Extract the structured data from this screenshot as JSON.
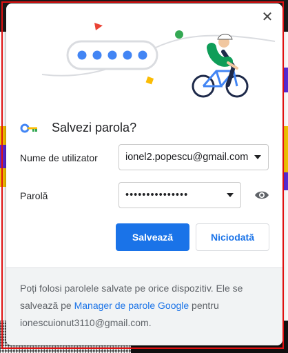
{
  "dialog": {
    "close_label": "✕",
    "title": "Salvezi parola?",
    "username_label": "Nume de utilizator",
    "username_value": "ionel2.popescu@gmail.com",
    "password_label": "Parolă",
    "password_value": "•••••••••••••••",
    "save_button": "Salvează",
    "never_button": "Niciodată"
  },
  "footer": {
    "text_before": "Poți folosi parolele salvate pe orice dispozitiv. Ele se salvează pe ",
    "link": "Manager de parole Google",
    "text_after": " pentru ionescuionut3110@gmail.com."
  },
  "colors": {
    "accent": "#1a73e8",
    "footer_bg": "#f1f3f4"
  },
  "icons": [
    "close-icon",
    "key-icon",
    "eye-icon",
    "chevron-down-icon"
  ]
}
